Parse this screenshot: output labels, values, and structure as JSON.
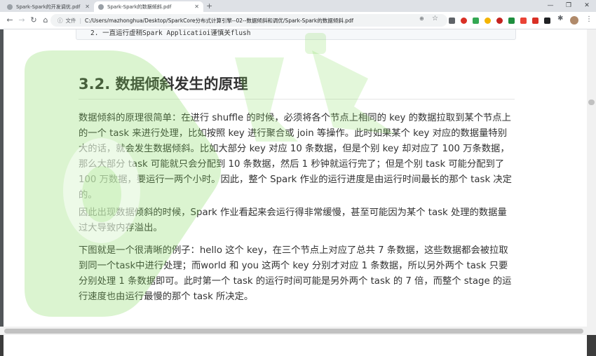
{
  "tabs": [
    {
      "title": "Spark-Spark的开发调优.pdf",
      "active": false
    },
    {
      "title": "Spark-Spark的数据倾斜.pdf",
      "active": true
    }
  ],
  "new_tab_label": "+",
  "address": {
    "file_label": "文件",
    "separator": "|",
    "url": "C:/Users/mazhonghua/Desktop/SparkCore分布式计算引擎--02--数据倾斜和调优/Spark-Spark的数据倾斜.pdf"
  },
  "document": {
    "code_fragment": "2.  一直运行虚稍Spark  Applicatioi谨慎关flush",
    "heading": "3.2. 数据倾斜发生的原理",
    "paragraphs": [
      "数据倾斜的原理很简单：在进行 shuffle 的时候，必须将各个节点上相同的 key 的数据拉取到某个节点上的一个 task 来进行处理，比如按照 key 进行聚合或 join 等操作。此时如果某个 key 对应的数据量特别大的话，就会发生数据倾斜。比如大部分 key 对应 10 条数据，但是个别 key 却对应了 100 万条数据，那么大部分 task 可能就只会分配到 10 条数据，然后 1 秒钟就运行完了；但是个别 task 可能分配到了 100 万数据，要运行一两个小时。因此，整个 Spark 作业的运行进度是由运行时间最长的那个 task 决定的。",
      "因此出现数据倾斜的时候，Spark 作业看起来会运行得非常缓慢，甚至可能因为某个 task 处理的数据量过大导致内存溢出。",
      "下图就是一个很清晰的例子：hello 这个 key，在三个节点上对应了总共 7 条数据，这些数据都会被拉取到同一个task中进行处理；而world 和 you 这两个 key 分别才对应 1 条数据，所以另外两个 task 只要分别处理 1 条数据即可。此时第一个 task 的运行时间可能是另外两个 task 的 7 倍，而整个 stage 的运行速度也由运行最慢的那个 task 所决定。"
    ]
  },
  "icons": [
    "back-icon",
    "forward-icon",
    "reload-icon",
    "home-icon",
    "info-icon",
    "zoom-icon",
    "star-icon",
    "extension-icon",
    "profile-avatar",
    "menu-icon"
  ],
  "colors": {
    "watermark": "#7ed957",
    "tab_bar": "#dee1e6",
    "text": "#333333"
  }
}
